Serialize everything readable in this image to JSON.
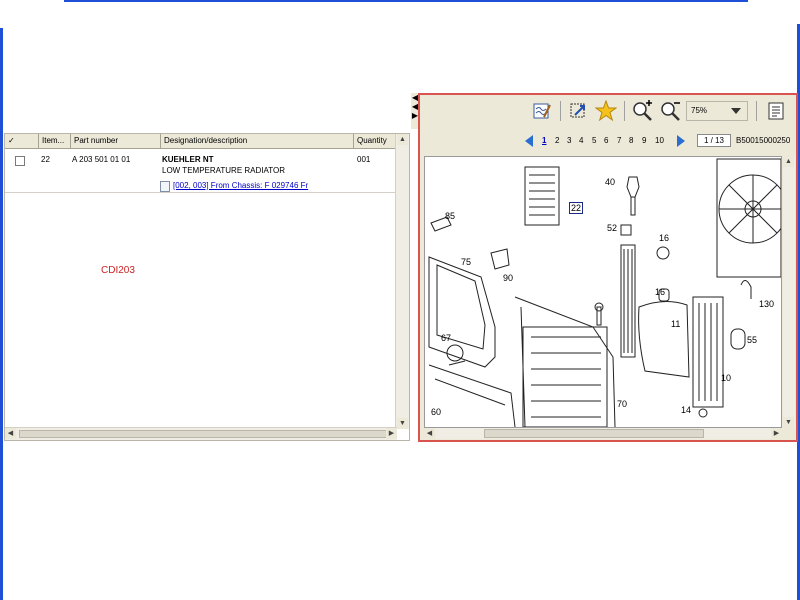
{
  "parts_list": {
    "columns": [
      "✓",
      "Item...",
      "Part number",
      "Designation/description",
      "Quantity"
    ],
    "rows": [
      {
        "item": "22",
        "part_number": "A 203 501 01 01",
        "designation": "KUEHLER NT",
        "description": "LOW TEMPERATURE RADIATOR",
        "quantity": "001",
        "note_link": "[002, 003] From Chassis: F 029746 Fr"
      }
    ],
    "annotation": "CDI203",
    "annotation_color": "#cc2222"
  },
  "viewer": {
    "zoom": "75%",
    "pages": [
      "1",
      "2",
      "3",
      "4",
      "5",
      "6",
      "7",
      "8",
      "9",
      "10"
    ],
    "current_page": "1",
    "page_indicator": "1 / 13",
    "document_id": "B50015000250",
    "highlight_color": "#1a2b8c",
    "toolbar_icons": [
      "edit-note-icon",
      "select-area-icon",
      "favorite-star-icon",
      "zoom-in-icon",
      "zoom-out-icon",
      "page-view-icon"
    ],
    "callouts": [
      "22",
      "40",
      "85",
      "52",
      "16",
      "75",
      "90",
      "16",
      "11",
      "130",
      "67",
      "55",
      "10",
      "60",
      "70",
      "14"
    ]
  },
  "colors": {
    "frame_blue": "#1f4fd6",
    "viewer_border": "#d9534f",
    "link": "#0000c8"
  }
}
